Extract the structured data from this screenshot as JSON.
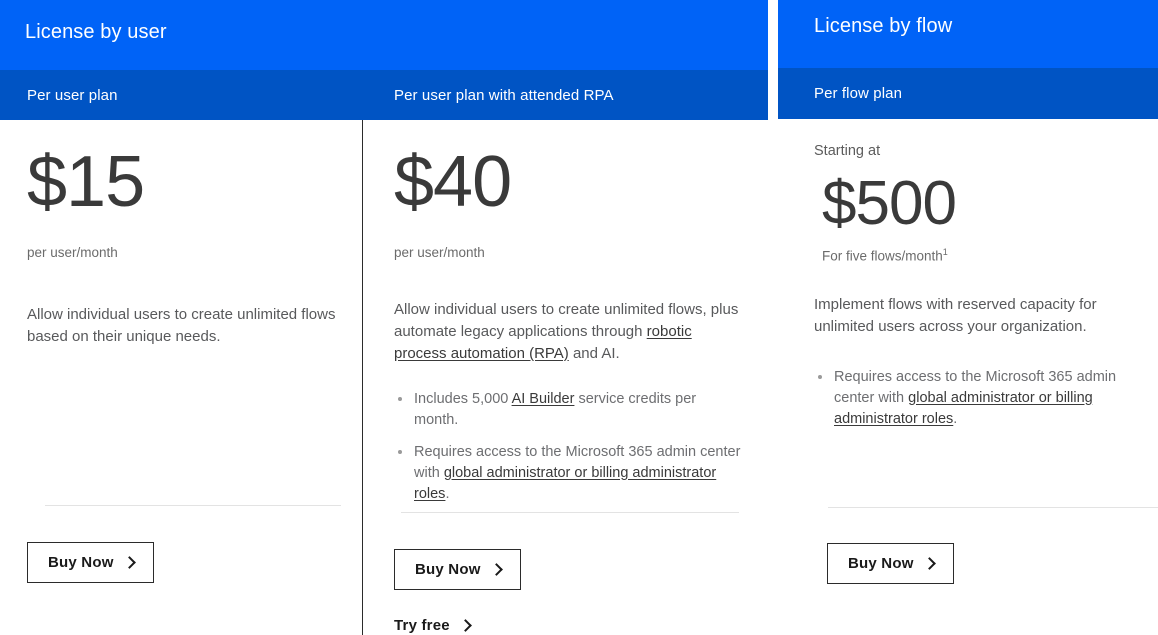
{
  "colors": {
    "banner_blue": "#0063f7",
    "subbar_blue": "#0054c4",
    "price_gray": "#3a3a3a",
    "body_gray": "#58595b",
    "rule_gray": "#e3e3e3"
  },
  "panels": [
    {
      "id": "license-by-user",
      "banner_title": "License by user",
      "columns": [
        {
          "id": "per-user-plan",
          "subheader": "Per user plan",
          "price": "$15",
          "price_sub": "per user/month",
          "description": "Allow individual users to create unlimited flows based on their unique needs.",
          "bullets": [],
          "buy_label": "Buy Now",
          "try_free_label": ""
        },
        {
          "id": "per-user-plan-attended-rpa",
          "subheader": "Per user plan with attended RPA",
          "price": "$40",
          "price_sub": "per user/month",
          "description_parts": [
            {
              "text": "Allow individual users to create unlimited flows, plus automate legacy applications through ",
              "link": false
            },
            {
              "text": "robotic process automation (RPA)",
              "link": true
            },
            {
              "text": " and AI.",
              "link": false
            }
          ],
          "bullets": [
            [
              {
                "text": "Includes 5,000 ",
                "link": false
              },
              {
                "text": "AI Builder",
                "link": true
              },
              {
                "text": " service credits per month.",
                "link": false
              }
            ],
            [
              {
                "text": "Requires access to the Microsoft 365 admin center with ",
                "link": false
              },
              {
                "text": "global administrator or billing administrator roles",
                "link": true
              },
              {
                "text": ".",
                "link": false
              }
            ]
          ],
          "buy_label": "Buy Now",
          "try_free_label": "Try free"
        }
      ]
    },
    {
      "id": "license-by-flow",
      "banner_title": "License by flow",
      "columns": [
        {
          "id": "per-flow-plan",
          "subheader": "Per flow plan",
          "starting_at": "Starting at",
          "price": "$500",
          "price_sub": "For five flows/month",
          "price_sub_superscript": "1",
          "description": "Implement flows with reserved capacity for unlimited users across your organization.",
          "bullets": [
            [
              {
                "text": "Requires access to the Microsoft 365 admin center with ",
                "link": false
              },
              {
                "text": "global administrator or billing administrator roles",
                "link": true
              },
              {
                "text": ".",
                "link": false
              }
            ]
          ],
          "buy_label": "Buy Now",
          "try_free_label": ""
        }
      ]
    }
  ],
  "icons": {
    "chevron_right": "chevron-right-icon"
  }
}
